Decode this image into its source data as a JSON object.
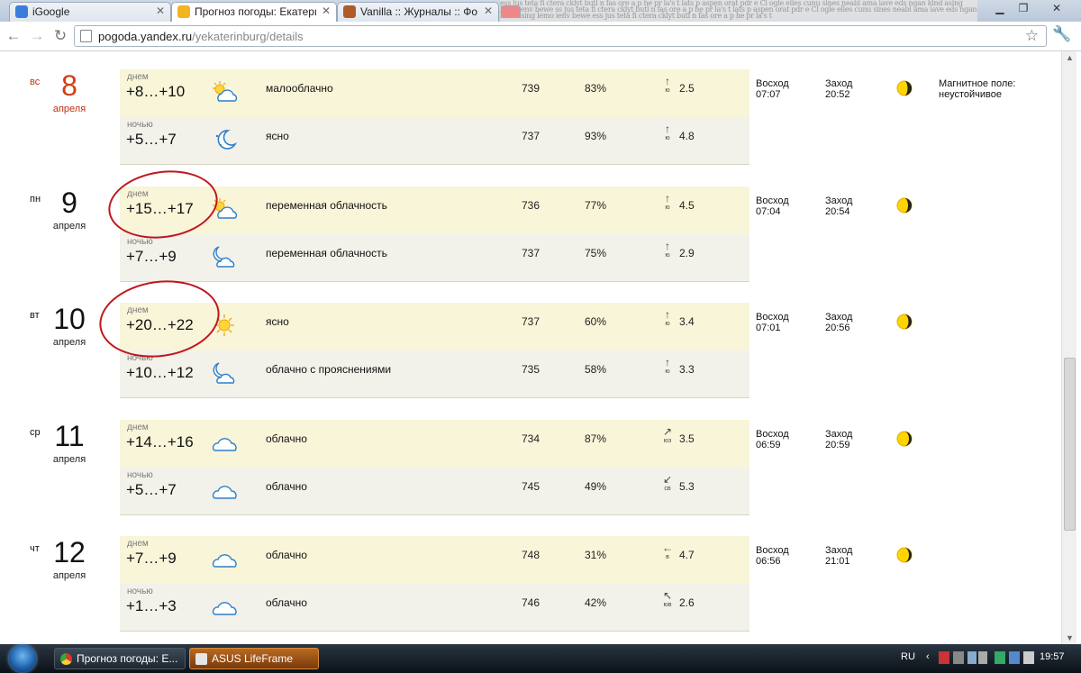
{
  "browser": {
    "tabs": [
      {
        "title": "iGoogle",
        "favicon_color": "#3b7ddd"
      },
      {
        "title": "Прогноз погоды: Екатерин",
        "favicon_color": "#f2b420"
      },
      {
        "title": "Vanilla :: Журналы :: Фору",
        "favicon_color": "#b05a2a"
      }
    ],
    "url_host": "pogoda.yandex.ru",
    "url_path": "/yekaterinburg/details"
  },
  "days": [
    {
      "dow": "вс",
      "date": "8",
      "month": "апреля",
      "weekend": true,
      "day_label": "днем",
      "day_temp": "+8…+10",
      "day_icon": "partly-cloudy-icon",
      "day_cond": "малооблачно",
      "day_press": "739",
      "day_hum": "83%",
      "day_wdir_arrow": "↑",
      "day_wdir": "ю",
      "day_wspeed": "2.5",
      "night_label": "ночью",
      "night_temp": "+5…+7",
      "night_icon": "night-clear-icon",
      "night_cond": "ясно",
      "night_press": "737",
      "night_hum": "93%",
      "night_wdir_arrow": "↑",
      "night_wdir": "ю",
      "night_wspeed": "4.8",
      "sunrise_label": "Восход",
      "sunrise": "07:07",
      "sunset_label": "Заход",
      "sunset": "20:52",
      "magnetic": "Магнитное поле: неустойчивое"
    },
    {
      "dow": "пн",
      "date": "9",
      "month": "апреля",
      "weekend": false,
      "day_label": "днем",
      "day_temp": "+15…+17",
      "day_icon": "partly-cloudy-icon",
      "day_cond": "переменная облачность",
      "day_press": "736",
      "day_hum": "77%",
      "day_wdir_arrow": "↑",
      "day_wdir": "ю",
      "day_wspeed": "4.5",
      "night_label": "ночью",
      "night_temp": "+7…+9",
      "night_icon": "night-cloudy-icon",
      "night_cond": "переменная облачность",
      "night_press": "737",
      "night_hum": "75%",
      "night_wdir_arrow": "↑",
      "night_wdir": "ю",
      "night_wspeed": "2.9",
      "sunrise_label": "Восход",
      "sunrise": "07:04",
      "sunset_label": "Заход",
      "sunset": "20:54",
      "magnetic": ""
    },
    {
      "dow": "вт",
      "date": "10",
      "month": "апреля",
      "weekend": false,
      "day_label": "днем",
      "day_temp": "+20…+22",
      "day_icon": "sun-icon",
      "day_cond": "ясно",
      "day_press": "737",
      "day_hum": "60%",
      "day_wdir_arrow": "↑",
      "day_wdir": "ю",
      "day_wspeed": "3.4",
      "night_label": "ночью",
      "night_temp": "+10…+12",
      "night_icon": "night-cloudy-icon",
      "night_cond": "облачно с прояснениями",
      "night_press": "735",
      "night_hum": "58%",
      "night_wdir_arrow": "↑",
      "night_wdir": "ю",
      "night_wspeed": "3.3",
      "sunrise_label": "Восход",
      "sunrise": "07:01",
      "sunset_label": "Заход",
      "sunset": "20:56",
      "magnetic": ""
    },
    {
      "dow": "ср",
      "date": "11",
      "month": "апреля",
      "weekend": false,
      "day_label": "днем",
      "day_temp": "+14…+16",
      "day_icon": "cloud-icon",
      "day_cond": "облачно",
      "day_press": "734",
      "day_hum": "87%",
      "day_wdir_arrow": "↗",
      "day_wdir": "юз",
      "day_wspeed": "3.5",
      "night_label": "ночью",
      "night_temp": "+5…+7",
      "night_icon": "cloud-icon",
      "night_cond": "облачно",
      "night_press": "745",
      "night_hum": "49%",
      "night_wdir_arrow": "↙",
      "night_wdir": "св",
      "night_wspeed": "5.3",
      "sunrise_label": "Восход",
      "sunrise": "06:59",
      "sunset_label": "Заход",
      "sunset": "20:59",
      "magnetic": ""
    },
    {
      "dow": "чт",
      "date": "12",
      "month": "апреля",
      "weekend": false,
      "day_label": "днем",
      "day_temp": "+7…+9",
      "day_icon": "cloud-icon",
      "day_cond": "облачно",
      "day_press": "748",
      "day_hum": "31%",
      "day_wdir_arrow": "←",
      "day_wdir": "в",
      "day_wspeed": "4.7",
      "night_label": "ночью",
      "night_temp": "+1…+3",
      "night_icon": "cloud-icon",
      "night_cond": "облачно",
      "night_press": "746",
      "night_hum": "42%",
      "night_wdir_arrow": "↖",
      "night_wdir": "юв",
      "night_wspeed": "2.6",
      "sunrise_label": "Восход",
      "sunrise": "06:56",
      "sunset_label": "Заход",
      "sunset": "21:01",
      "magnetic": ""
    }
  ],
  "moon_phases": [
    0.45,
    0.5,
    0.55,
    0.6,
    0.65
  ],
  "taskbar": {
    "items": [
      {
        "label": "Прогноз погоды: Е..."
      },
      {
        "label": "ASUS LifeFrame"
      }
    ],
    "lang": "RU",
    "clock": "19:57"
  }
}
